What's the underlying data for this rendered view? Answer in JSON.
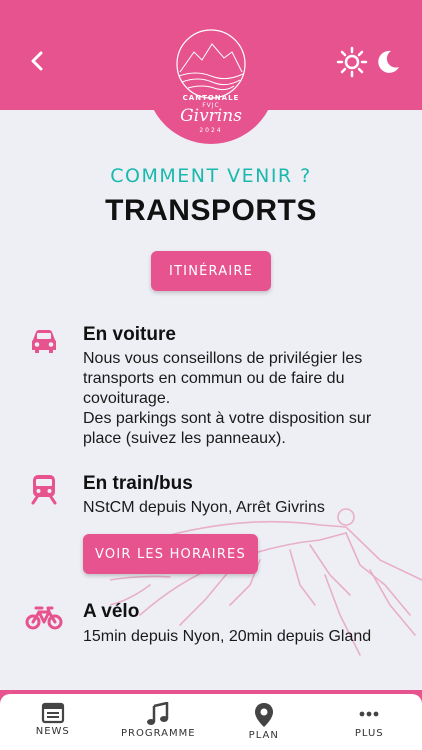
{
  "header": {
    "logo": {
      "line1": "CANTONALE",
      "line2": "FVJC",
      "line3": "Givrins",
      "line4": "2024"
    },
    "theme_icons": [
      "sun-icon",
      "moon-icon"
    ]
  },
  "page": {
    "subtitle": "COMMENT VENIR ?",
    "title": "TRANSPORTS",
    "itinerary_button": "ITINÉRAIRE"
  },
  "sections": [
    {
      "icon": "car-icon",
      "title": "En voiture",
      "lines": [
        "Nous vous conseillons de privilégier les",
        "transports en commun ou de faire du",
        "covoiturage.",
        "Des parkings sont à votre disposition sur",
        "place (suivez les panneaux)."
      ]
    },
    {
      "icon": "train-icon",
      "title": "En train/bus",
      "lines": [
        "NStCM depuis Nyon, Arrêt Givrins"
      ],
      "button": "VOIR LES HORAIRES"
    },
    {
      "icon": "bike-icon",
      "title": "A vélo",
      "lines": [
        "15min depuis Nyon, 20min depuis Gland"
      ]
    }
  ],
  "bottom_nav": [
    {
      "label": "NEWS",
      "icon": "news-icon"
    },
    {
      "label": "PROGRAMME",
      "icon": "music-note-icon"
    },
    {
      "label": "PLAN",
      "icon": "map-pin-icon"
    },
    {
      "label": "PLUS",
      "icon": "more-icon"
    }
  ],
  "colors": {
    "accent": "#e6538f",
    "teal": "#19b9ad",
    "background": "#eeeff5"
  }
}
